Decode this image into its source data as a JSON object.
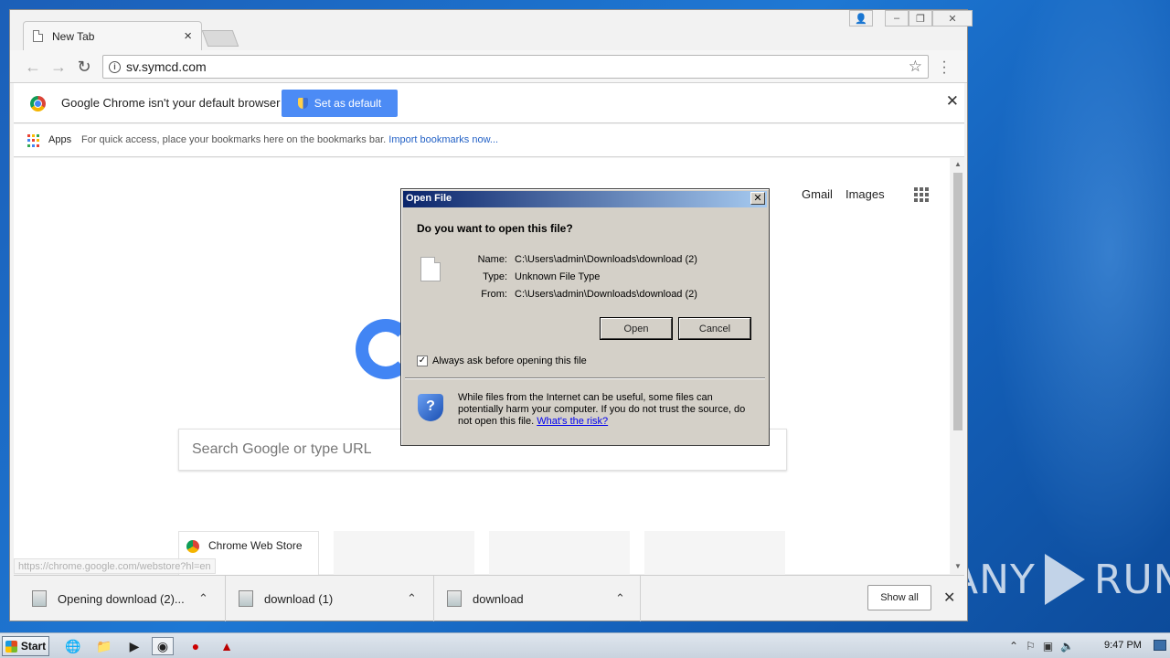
{
  "browser": {
    "tab_title": "New Tab",
    "url": "sv.symcd.com",
    "infobar": {
      "message": "Google Chrome isn't your default browser",
      "button": "Set as default"
    },
    "bookmarks": {
      "apps_label": "Apps",
      "hint": "For quick access, place your bookmarks here on the bookmarks bar.",
      "import_link": "Import bookmarks now..."
    },
    "ntp": {
      "links": [
        "Gmail",
        "Images"
      ],
      "search_placeholder": "Search Google or type URL",
      "tiles": [
        "Chrome Web Store"
      ],
      "status_url": "https://chrome.google.com/webstore?hl=en"
    },
    "downloads": {
      "items": [
        {
          "name": "Opening download (2)..."
        },
        {
          "name": "download (1)"
        },
        {
          "name": "download"
        }
      ],
      "show_all": "Show all"
    }
  },
  "dialog": {
    "title": "Open File",
    "question": "Do you want to open this file?",
    "fields": {
      "name_label": "Name:",
      "name_value": "C:\\Users\\admin\\Downloads\\download (2)",
      "type_label": "Type:",
      "type_value": "Unknown File Type",
      "from_label": "From:",
      "from_value": "C:\\Users\\admin\\Downloads\\download (2)"
    },
    "open_button": "Open",
    "cancel_button": "Cancel",
    "checkbox_label": "Always ask before opening this file",
    "checkbox_checked": true,
    "warning_text": "While files from the Internet can be useful, some files can potentially harm your computer. If you do not trust the source, do not open this file.",
    "risk_link": "What's the risk?"
  },
  "taskbar": {
    "start_label": "Start",
    "clock": "9:47 PM"
  },
  "watermark": {
    "left": "ANY",
    "right": "RUN"
  },
  "colors": {
    "set_default_bg": "#4c8bf5",
    "dialog_bg": "#d4d0c8",
    "title_gradient_start": "#0a246a",
    "link": "#2462c6"
  }
}
